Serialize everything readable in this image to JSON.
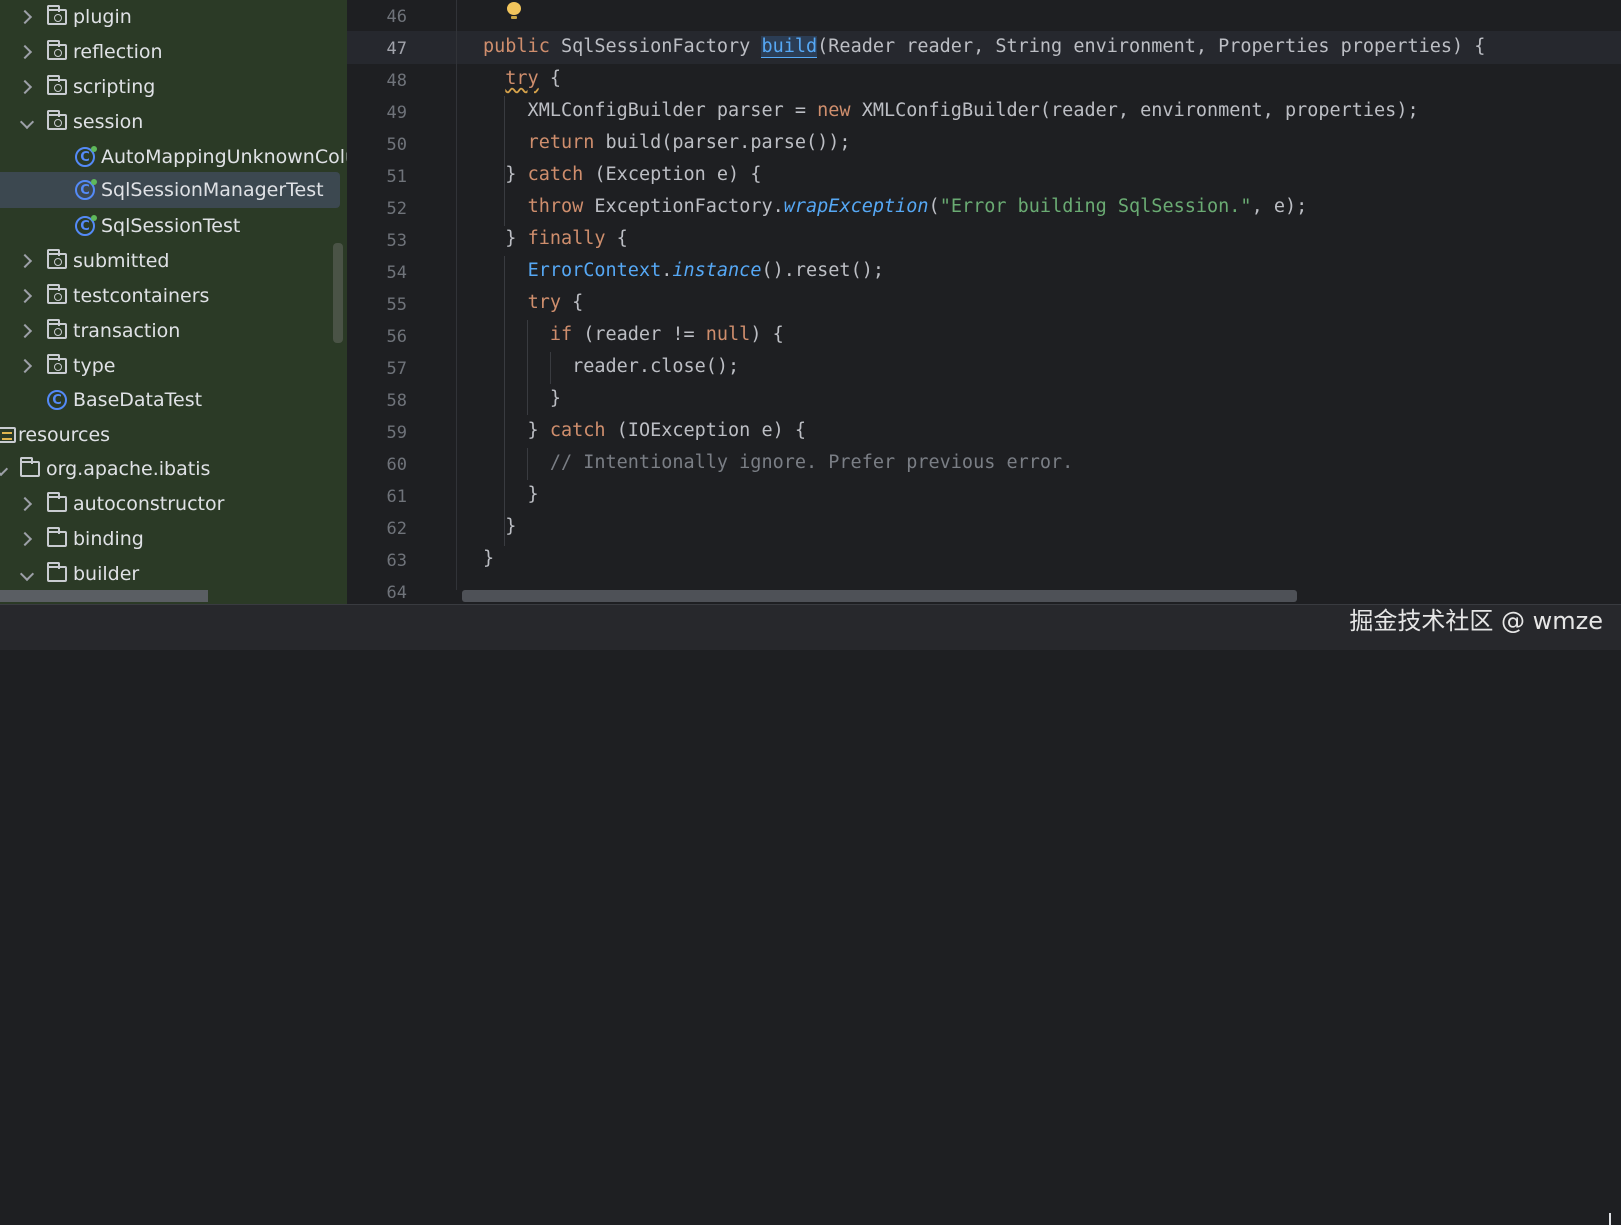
{
  "tree": {
    "items": [
      {
        "label": "plugin",
        "icon": "package-folder-icon",
        "arrow": "right"
      },
      {
        "label": "reflection",
        "icon": "package-folder-icon",
        "arrow": "right"
      },
      {
        "label": "scripting",
        "icon": "package-folder-icon",
        "arrow": "right"
      },
      {
        "label": "session",
        "icon": "package-folder-icon",
        "arrow": "down"
      },
      {
        "label": "AutoMappingUnknownColum",
        "icon": "test-class-icon"
      },
      {
        "label": "SqlSessionManagerTest",
        "icon": "test-class-icon",
        "selected": true
      },
      {
        "label": "SqlSessionTest",
        "icon": "test-class-icon"
      },
      {
        "label": "submitted",
        "icon": "package-folder-icon",
        "arrow": "right"
      },
      {
        "label": "testcontainers",
        "icon": "package-folder-icon",
        "arrow": "right"
      },
      {
        "label": "transaction",
        "icon": "package-folder-icon",
        "arrow": "right"
      },
      {
        "label": "type",
        "icon": "package-folder-icon",
        "arrow": "right"
      },
      {
        "label": "BaseDataTest",
        "icon": "class-icon"
      },
      {
        "label": "resources",
        "icon": "resources-folder-icon"
      },
      {
        "label": "org.apache.ibatis",
        "icon": "folder-icon",
        "arrow": "down"
      },
      {
        "label": "autoconstructor",
        "icon": "folder-icon",
        "arrow": "right"
      },
      {
        "label": "binding",
        "icon": "folder-icon",
        "arrow": "right"
      },
      {
        "label": "builder",
        "icon": "folder-icon",
        "arrow": "down"
      }
    ]
  },
  "editor": {
    "current_line": "47",
    "lines": [
      {
        "num": "46",
        "code": ""
      },
      {
        "num": "47",
        "code": "public SqlSessionFactory build(Reader reader, String environment, Properties properties) {"
      },
      {
        "num": "48",
        "code": "  try {"
      },
      {
        "num": "49",
        "code": "    XMLConfigBuilder parser = new XMLConfigBuilder(reader, environment, properties);"
      },
      {
        "num": "50",
        "code": "    return build(parser.parse());"
      },
      {
        "num": "51",
        "code": "  } catch (Exception e) {"
      },
      {
        "num": "52",
        "code": "    throw ExceptionFactory.wrapException(\"Error building SqlSession.\", e);"
      },
      {
        "num": "53",
        "code": "  } finally {"
      },
      {
        "num": "54",
        "code": "    ErrorContext.instance().reset();"
      },
      {
        "num": "55",
        "code": "    try {"
      },
      {
        "num": "56",
        "code": "      if (reader != null) {"
      },
      {
        "num": "57",
        "code": "        reader.close();"
      },
      {
        "num": "58",
        "code": "      }"
      },
      {
        "num": "59",
        "code": "    } catch (IOException e) {"
      },
      {
        "num": "60",
        "code": "      // Intentionally ignore. Prefer previous error."
      },
      {
        "num": "61",
        "code": "    }"
      },
      {
        "num": "62",
        "code": "  }"
      },
      {
        "num": "63",
        "code": "}"
      },
      {
        "num": "64",
        "code": ""
      }
    ]
  },
  "watermark": "掘金技术社区 @ wmze",
  "colors": {
    "keyword": "#cf8e6d",
    "string": "#6aab73",
    "comment": "#7a7e85",
    "method": "#56a8f5",
    "text": "#bcbec4",
    "tree_bg": "#2b3a26",
    "editor_bg": "#1e1f22"
  }
}
